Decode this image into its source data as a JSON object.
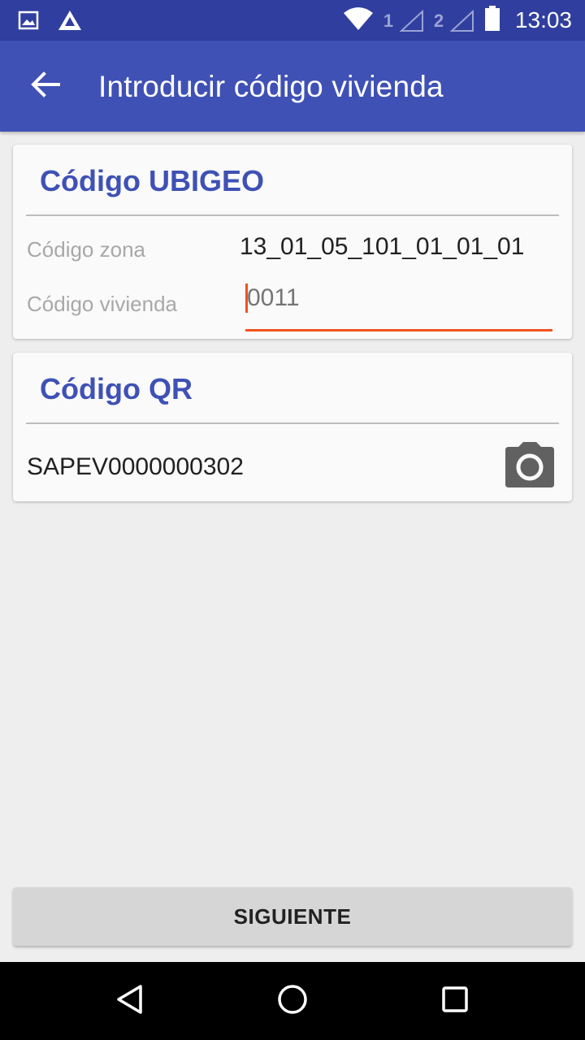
{
  "status_bar": {
    "time": "13:03",
    "sim1_label": "1",
    "sim2_label": "2",
    "icons": [
      "image-icon",
      "app-icon",
      "wifi-icon",
      "signal-icon",
      "battery-icon"
    ]
  },
  "app_bar": {
    "title": "Introducir código vivienda",
    "back_icon": "arrow-back-icon"
  },
  "ubigeo_card": {
    "title": "Código UBIGEO",
    "zona_label": "Código zona",
    "zona_value": "13_01_05_101_01_01_01",
    "vivienda_label": "Código vivienda",
    "vivienda_value": "0011"
  },
  "qr_card": {
    "title": "Código QR",
    "qr_value": "SAPEV0000000302",
    "camera_icon": "camera-icon"
  },
  "footer": {
    "next_label": "SIGUIENTE"
  },
  "nav_bar": {
    "icons": [
      "back-triangle-icon",
      "home-circle-icon",
      "recents-square-icon"
    ]
  },
  "colors": {
    "primary": "#3f51b5",
    "primary_dark": "#303f9f",
    "accent": "#f4511e",
    "background": "#eeeeee"
  }
}
